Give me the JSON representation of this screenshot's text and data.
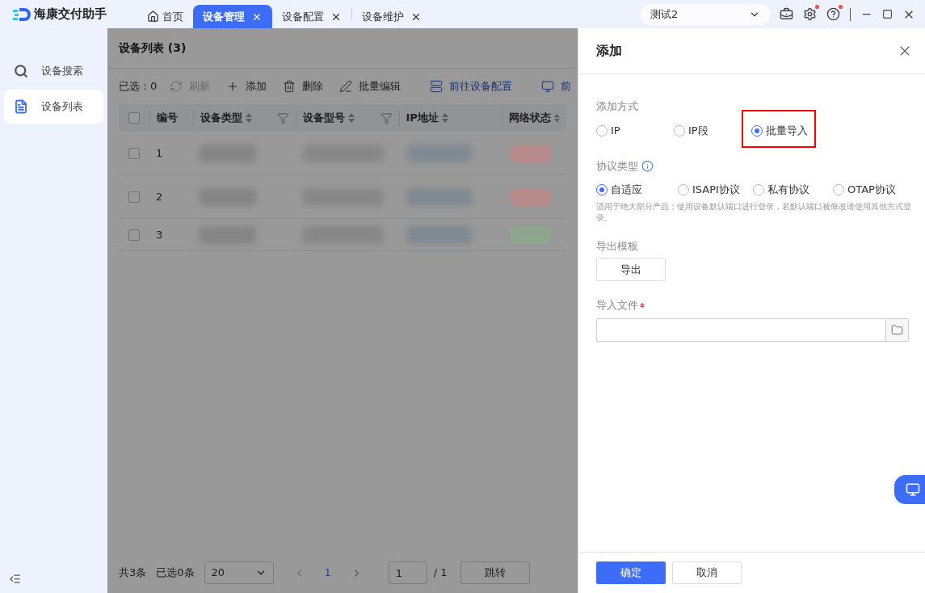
{
  "app": {
    "title": "海康交付助手"
  },
  "tabs": [
    {
      "label": "首页",
      "selected": false,
      "kind": "home"
    },
    {
      "label": "设备管理",
      "selected": true,
      "kind": "closable"
    },
    {
      "label": "设备配置",
      "selected": false,
      "kind": "closable"
    },
    {
      "label": "设备维护",
      "selected": false,
      "kind": "closable"
    }
  ],
  "account": {
    "value": "测试2"
  },
  "title_icons": [
    {
      "kind": "toolbox",
      "dot": false
    },
    {
      "kind": "settings",
      "dot": true
    },
    {
      "kind": "help",
      "dot": true
    }
  ],
  "sidebar": {
    "items": [
      {
        "label": "设备搜索",
        "selected": false,
        "kind": "search"
      },
      {
        "label": "设备列表",
        "selected": true,
        "kind": "list"
      }
    ]
  },
  "list": {
    "title": "设备列表 (3)",
    "selected_count": "已选：0",
    "toolbar": [
      {
        "label": "刷新",
        "kind": "refresh",
        "disabled": true
      },
      {
        "label": "添加",
        "kind": "add",
        "disabled": false
      },
      {
        "label": "删除",
        "kind": "delete",
        "disabled": false
      },
      {
        "label": "批量编辑",
        "kind": "edit",
        "disabled": false
      },
      {
        "label": "前往设备配置",
        "kind": "config-link",
        "disabled": false
      },
      {
        "label": "前",
        "kind": "monitor-link",
        "disabled": false
      }
    ],
    "columns": [
      {
        "label": "编号",
        "sortable": false,
        "filter": false
      },
      {
        "label": "设备类型",
        "sortable": true,
        "filter": true
      },
      {
        "label": "设备型号",
        "sortable": true,
        "filter": true
      },
      {
        "label": "IP地址",
        "sortable": true,
        "filter": false
      },
      {
        "label": "网络状态",
        "sortable": true,
        "filter": false
      }
    ],
    "all_checked": false,
    "rows": [
      {
        "number": "1",
        "checked": false,
        "color": "#b98c8c"
      },
      {
        "number": "2",
        "checked": false,
        "color": "#b98c8c"
      },
      {
        "number": "3",
        "checked": false,
        "color": "#8ea58e"
      }
    ],
    "footer": {
      "total": "共3条",
      "selected": "已选0条",
      "page_size": "20",
      "page": "1",
      "jump_value": "1",
      "page_count": "/ 1",
      "jump": "跳转"
    }
  },
  "drawer": {
    "title": "添加",
    "method_label": "添加方式",
    "methods": [
      {
        "label": "IP",
        "selected": false
      },
      {
        "label": "IP段",
        "selected": false
      },
      {
        "label": "批量导入",
        "selected": true,
        "highlighted": true
      }
    ],
    "protocol_label": "协议类型",
    "protocols": [
      {
        "label": "自适应",
        "selected": true
      },
      {
        "label": "ISAPI协议",
        "selected": false
      },
      {
        "label": "私有协议",
        "selected": false
      },
      {
        "label": "OTAP协议",
        "selected": false
      }
    ],
    "protocol_hint": "适用于绝大部分产品；使用设备默认端口进行登录，若默认端口被修改请使用其他方式登录。",
    "template_label": "导出模板",
    "export_button": "导出",
    "file_label": "导入文件",
    "file_required": true,
    "buttons": [
      {
        "label": "确定",
        "kind": "primary"
      },
      {
        "label": "取消",
        "kind": "secondary"
      }
    ]
  }
}
